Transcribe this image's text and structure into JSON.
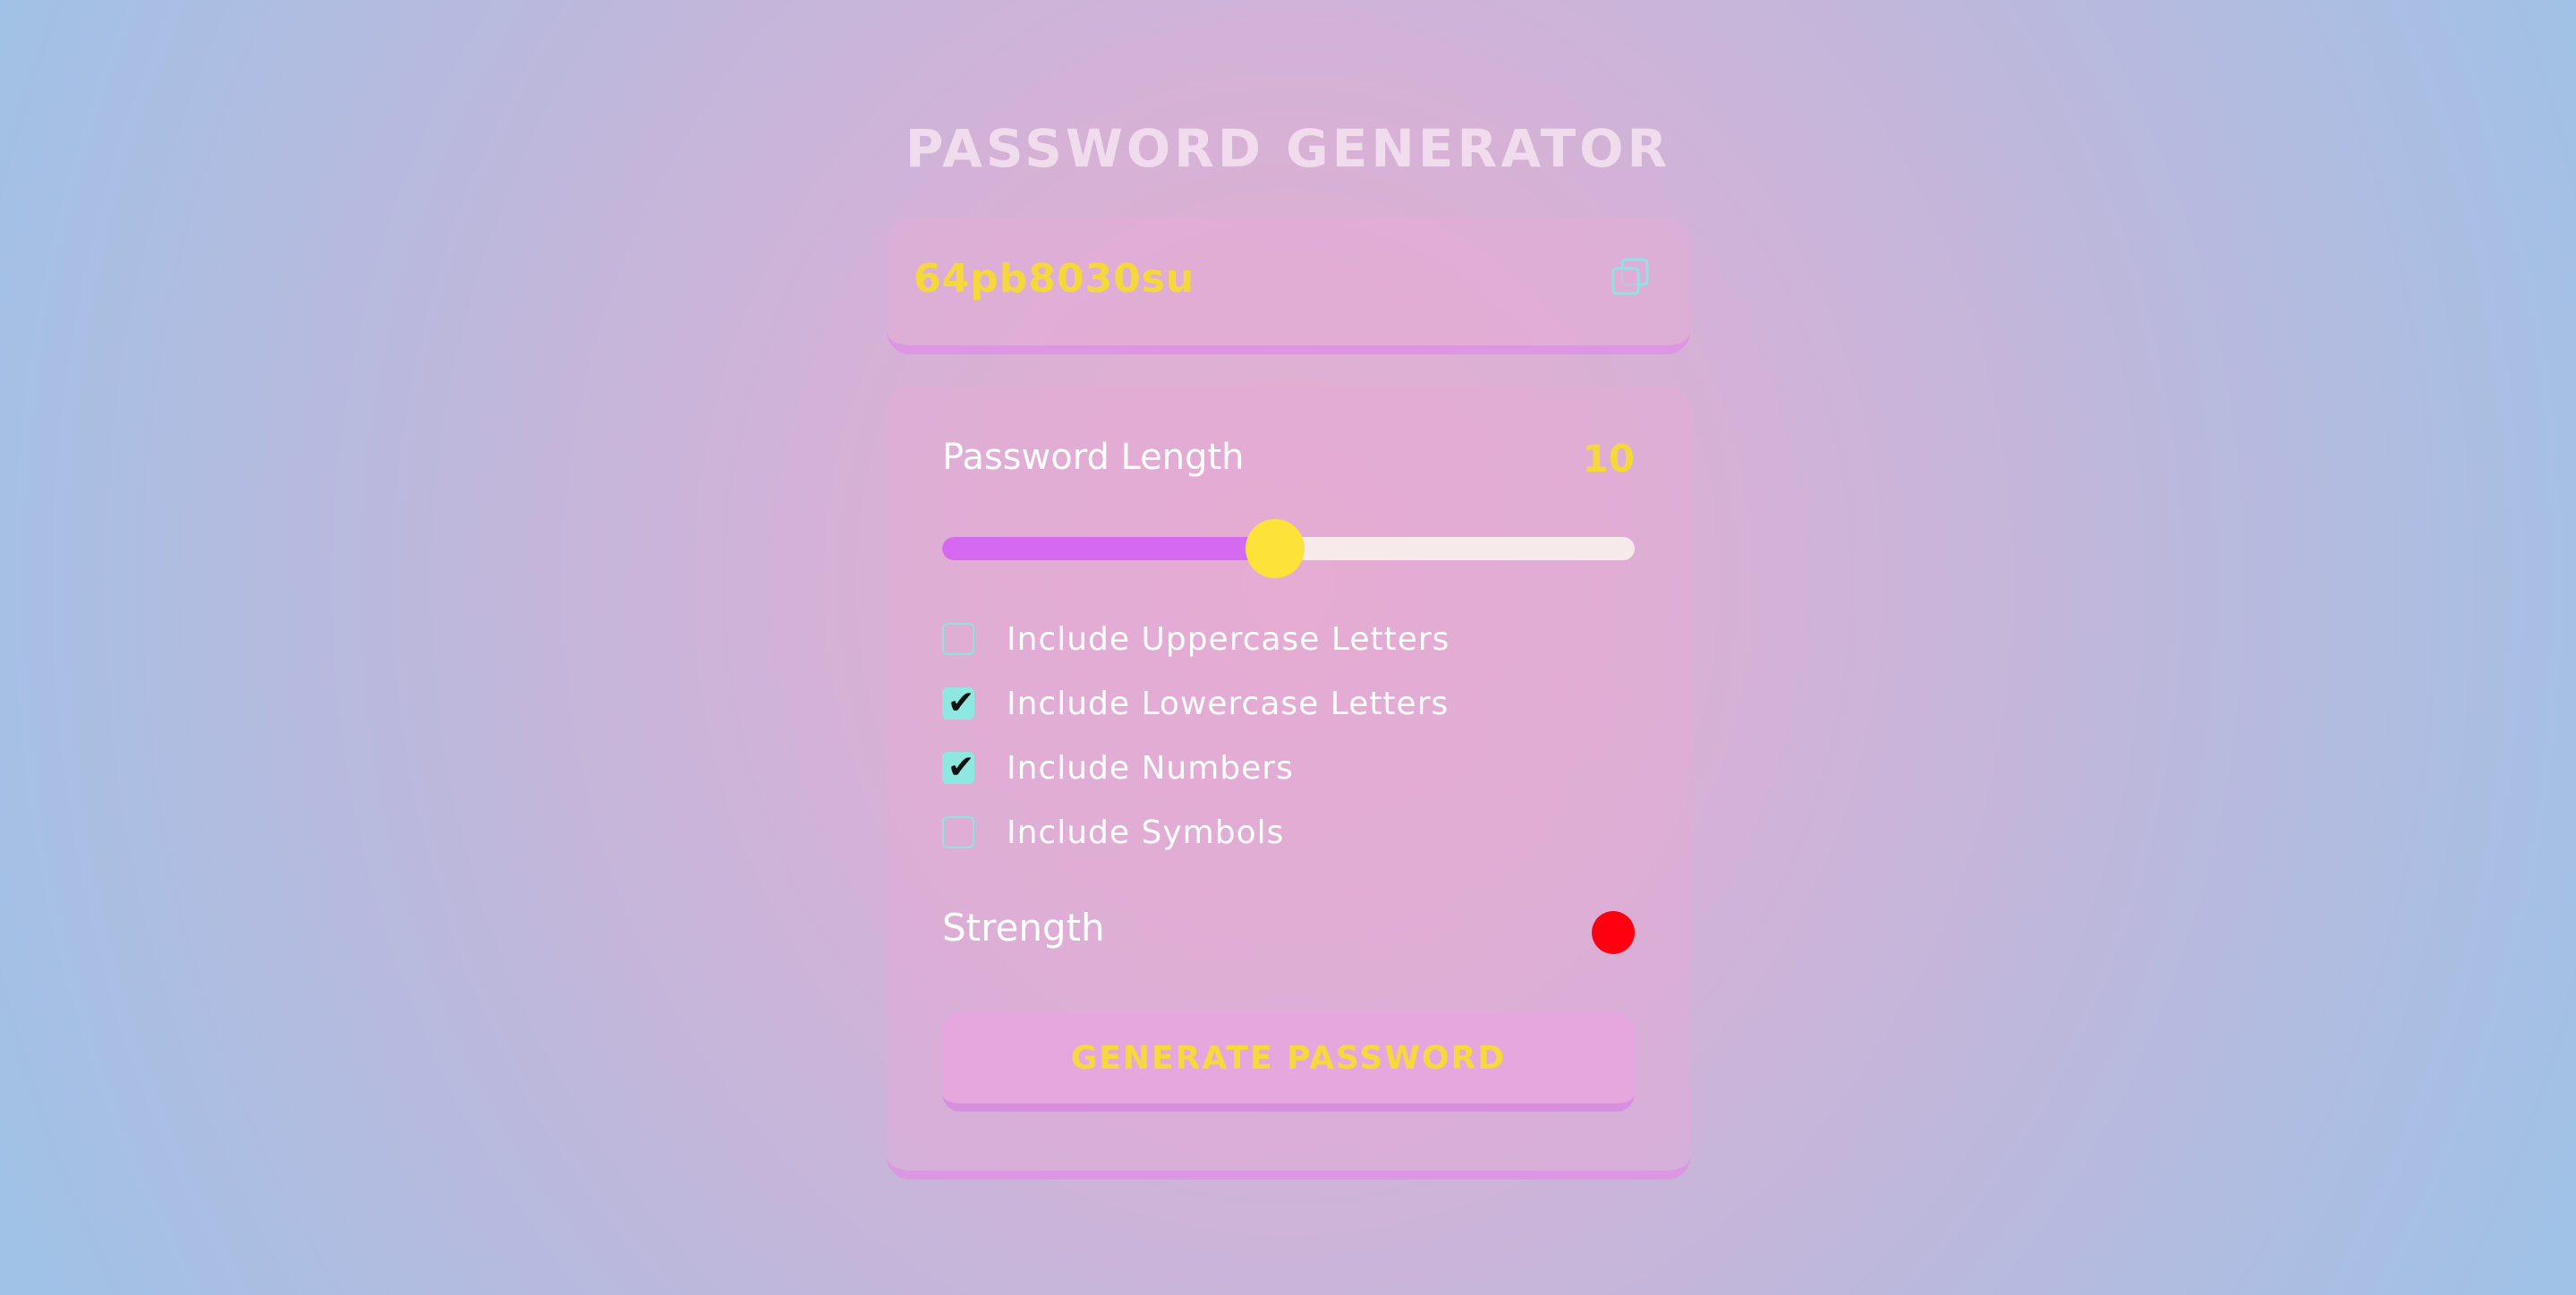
{
  "app": {
    "title": "PASSWORD GENERATOR"
  },
  "output": {
    "password": "64pb8030su",
    "copy_icon": "copy-icon"
  },
  "settings": {
    "length_label": "Password Length",
    "length_value": "10",
    "slider": {
      "min": 1,
      "max": 20,
      "value": 10,
      "fill_fraction": 0.48
    },
    "options": [
      {
        "label": "Include Uppercase Letters",
        "checked": false
      },
      {
        "label": "Include Lowercase Letters",
        "checked": true
      },
      {
        "label": "Include Numbers",
        "checked": true
      },
      {
        "label": "Include Symbols",
        "checked": false
      }
    ],
    "strength_label": "Strength",
    "strength_indicator_color": "#ff0010",
    "generate_label": "GENERATE PASSWORD"
  },
  "colors": {
    "accent_yellow": "#f5d93c",
    "accent_purple": "#d569ef",
    "checkbox_teal": "#8ee7e0"
  }
}
